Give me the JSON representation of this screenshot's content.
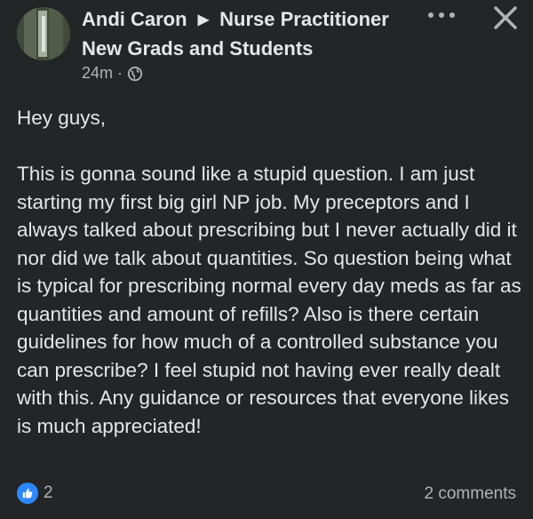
{
  "post": {
    "author": "Andi Caron",
    "group_line1": "Nurse Practitioner",
    "group_line2": "New Grads and Students",
    "separator_icon": "triangle-right-icon",
    "time": "24m",
    "dot": "·",
    "privacy_icon": "globe-icon",
    "greeting": "Hey guys,",
    "body": "This is gonna sound like a stupid question. I am just starting my first big girl NP job. My preceptors and I always talked about prescribing but I never actually did it nor did we talk about quantities. So question being what is typical for prescribing normal every day meds as far as quantities and amount of refills? Also is there certain guidelines for how much of a controlled substance you can prescribe? I feel stupid not having ever really dealt with this. Any guidance or resources that everyone likes is much appreciated!",
    "reactions_count": "2",
    "comments": "2 comments"
  },
  "colors": {
    "background": "#242526",
    "text": "#e4e6eb",
    "secondary_text": "#b0b3b8",
    "like_blue": "#2d88ff"
  }
}
